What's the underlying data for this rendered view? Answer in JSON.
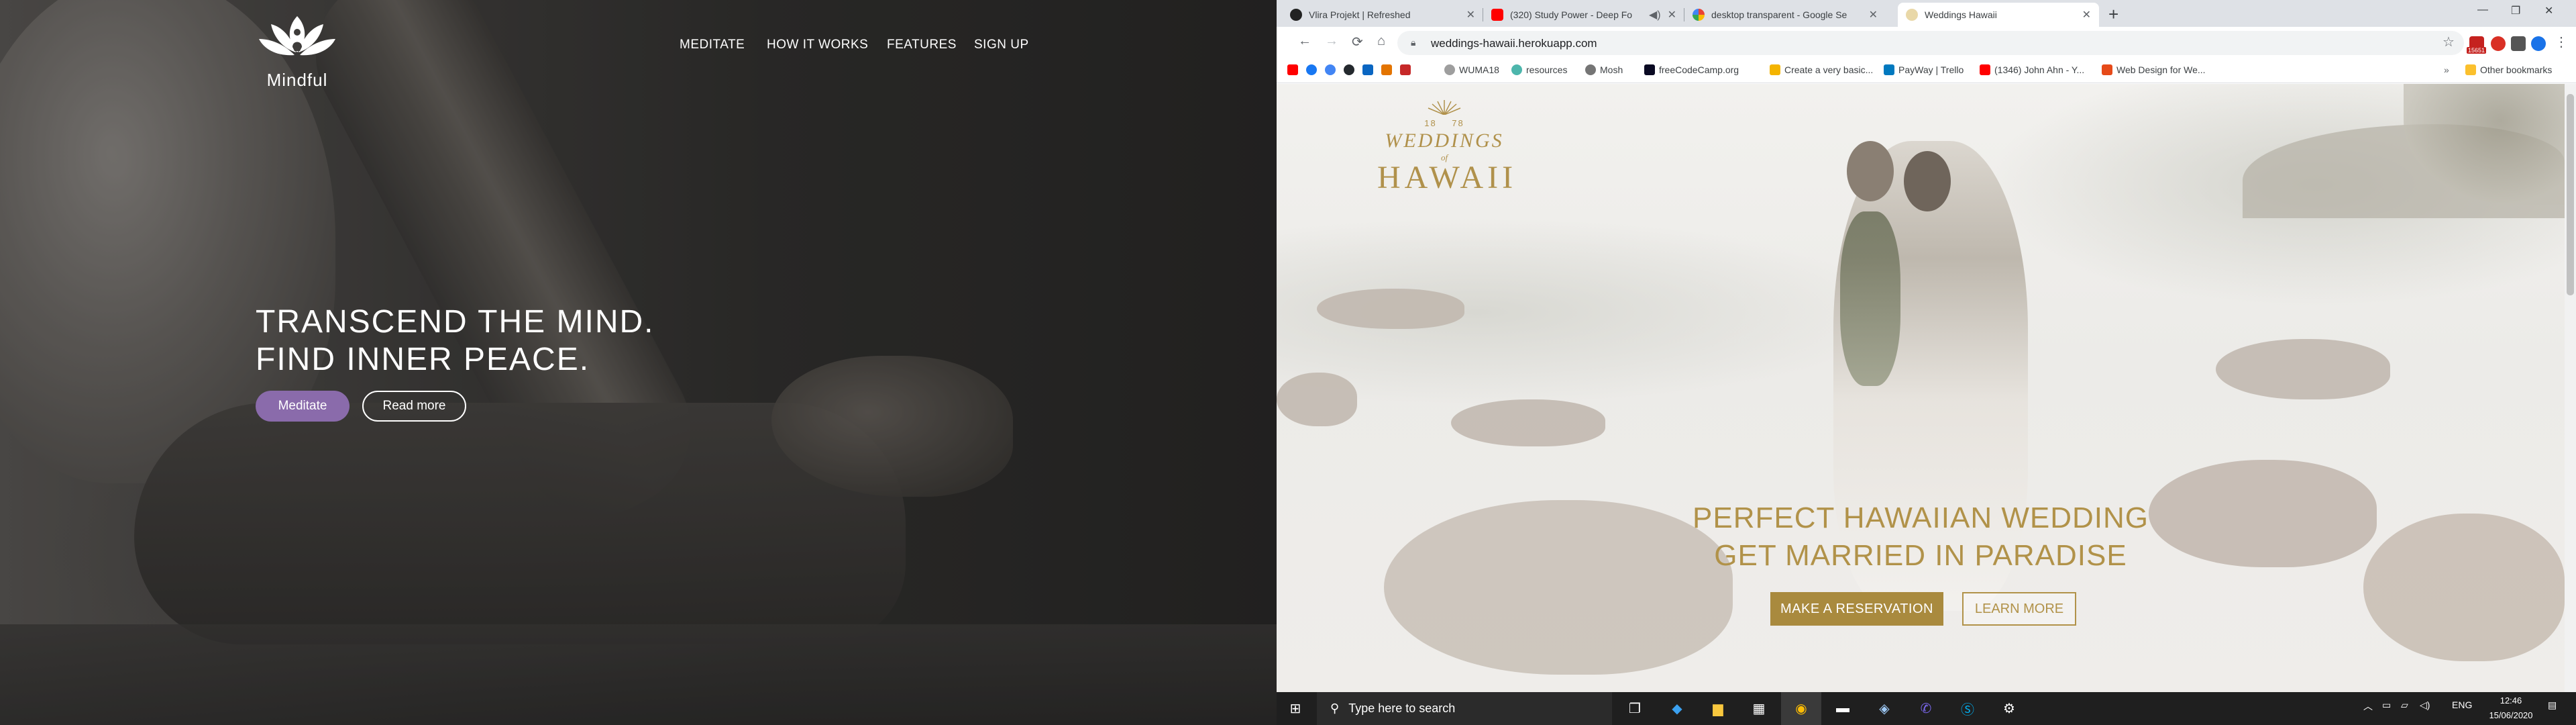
{
  "left_site": {
    "logo_text": "Mindful",
    "nav": [
      "MEDITATE",
      "HOW IT WORKS",
      "FEATURES",
      "SIGN UP"
    ],
    "hero_line1": "TRANSCEND THE MIND.",
    "hero_line2": "FIND INNER PEACE.",
    "btn_primary": "Meditate",
    "btn_secondary": "Read more"
  },
  "browser": {
    "tabs": [
      {
        "title": "Vlira Projekt | Refreshed",
        "icon": "vlira-icon",
        "active": false
      },
      {
        "title": "(320) Study Power - Deep Fo",
        "icon": "youtube-icon",
        "active": false
      },
      {
        "title": "desktop transparent - Google Se",
        "icon": "google-icon",
        "active": false
      },
      {
        "title": "Weddings Hawaii",
        "icon": "weddings-icon",
        "active": true
      }
    ],
    "url": "weddings-hawaii.herokuapp.com",
    "bookmarks": [
      "WUMA18",
      "resources",
      "Mosh",
      "freeCodeCamp.org",
      "Create a very basic...",
      "PayWay | Trello",
      "(1346) John Ahn - Y...",
      "Web Design for We..."
    ],
    "other_bookmarks": "Other bookmarks",
    "ext_badge": "15651"
  },
  "right_site": {
    "logo_year_left": "18",
    "logo_year_right": "78",
    "logo_line1": "WEDDINGS",
    "logo_line2": "of",
    "logo_line3": "HAWAII",
    "hero_line1": "PERFECT HAWAIIAN WEDDING",
    "hero_line2": "GET MARRIED IN PARADISE",
    "btn_primary": "MAKE A RESERVATION",
    "btn_secondary": "LEARN MORE"
  },
  "taskbar": {
    "search_placeholder": "Type here to search",
    "lang": "ENG",
    "time": "12:46",
    "date": "15/06/2020"
  },
  "colors": {
    "mindful_accent": "#8a6bab",
    "hawaii_gold": "#b19249",
    "taskbar": "#1f1f1f"
  }
}
